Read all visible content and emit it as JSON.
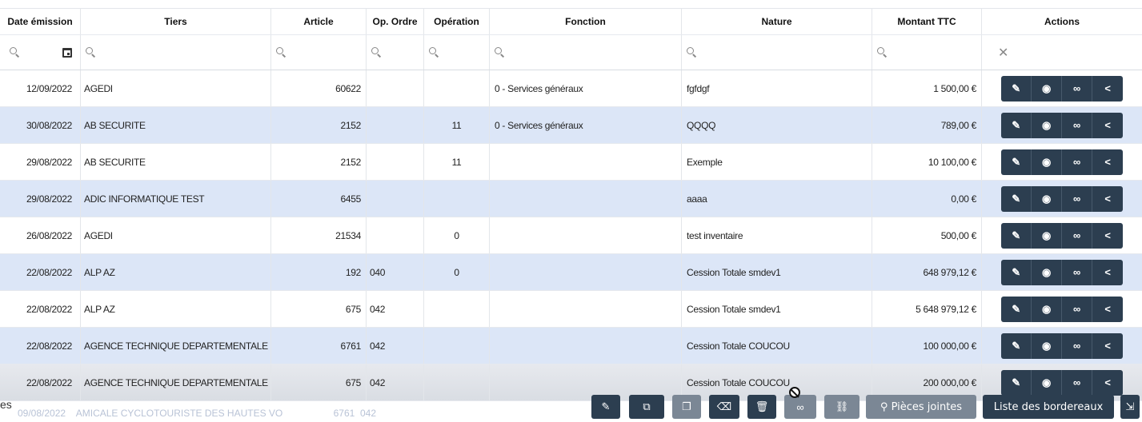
{
  "columns": [
    "Date émission",
    "Tiers",
    "Article",
    "Op. Ordre",
    "Opération",
    "Fonction",
    "Nature",
    "Montant TTC",
    "Actions"
  ],
  "rows": [
    {
      "date": "12/09/2022",
      "tiers": "AGEDI",
      "article": "60622",
      "op_ordre": "",
      "operation": "",
      "fonction": "0 - Services généraux",
      "nature": "fgfdgf",
      "montant": "1 500,00 €"
    },
    {
      "date": "30/08/2022",
      "tiers": "AB SECURITE",
      "article": "2152",
      "op_ordre": "",
      "operation": "11",
      "fonction": "0 - Services généraux",
      "nature": "QQQQ",
      "montant": "789,00 €"
    },
    {
      "date": "29/08/2022",
      "tiers": "AB SECURITE",
      "article": "2152",
      "op_ordre": "",
      "operation": "11",
      "fonction": "",
      "nature": "Exemple",
      "montant": "10 100,00 €"
    },
    {
      "date": "29/08/2022",
      "tiers": "ADIC INFORMATIQUE TEST",
      "article": "6455",
      "op_ordre": "",
      "operation": "",
      "fonction": "",
      "nature": "aaaa",
      "montant": "0,00 €"
    },
    {
      "date": "26/08/2022",
      "tiers": "AGEDI",
      "article": "21534",
      "op_ordre": "",
      "operation": "0",
      "fonction": "",
      "nature": "test inventaire",
      "montant": "500,00 €"
    },
    {
      "date": "22/08/2022",
      "tiers": "ALP AZ",
      "article": "192",
      "op_ordre": "040",
      "operation": "0",
      "fonction": "",
      "nature": "Cession Totale smdev1",
      "montant": "648 979,12 €"
    },
    {
      "date": "22/08/2022",
      "tiers": "ALP AZ",
      "article": "675",
      "op_ordre": "042",
      "operation": "",
      "fonction": "",
      "nature": "Cession Totale smdev1",
      "montant": "5 648 979,12 €"
    },
    {
      "date": "22/08/2022",
      "tiers": "AGENCE TECHNIQUE DEPARTEMENTALE",
      "article": "6761",
      "op_ordre": "042",
      "operation": "",
      "fonction": "",
      "nature": "Cession Totale COUCOU",
      "montant": "100 000,00 €"
    },
    {
      "date": "22/08/2022",
      "tiers": "AGENCE TECHNIQUE DEPARTEMENTALE",
      "article": "675",
      "op_ordre": "042",
      "operation": "",
      "fonction": "",
      "nature": "Cession Totale COUCOU",
      "montant": "200 000,00 €"
    }
  ],
  "hidden_row": {
    "date": "09/08/2022",
    "tiers": "AMICALE CYCLOTOURISTE DES HAUTES VO",
    "article": "6761",
    "op_ordre": "042"
  },
  "row_action_icons": [
    "edit-icon",
    "eye-icon",
    "link-icon",
    "share-icon"
  ],
  "filter_clear_icon": "close-icon",
  "toolbar": {
    "partial_label": "es",
    "pieces_jointes": "Pièces jointes",
    "liste_bordereaux": "Liste des bordereaux",
    "icons": [
      "pencil-icon",
      "copy-icon",
      "duplicate-icon",
      "eraser-icon",
      "trash-icon",
      "link-icon",
      "unlink-icon",
      "paperclip-icon",
      "export-icon"
    ]
  },
  "colors": {
    "button_dark": "#2c3e50",
    "row_alt": "#dce6f7",
    "button_disabled": "#7b8795"
  }
}
